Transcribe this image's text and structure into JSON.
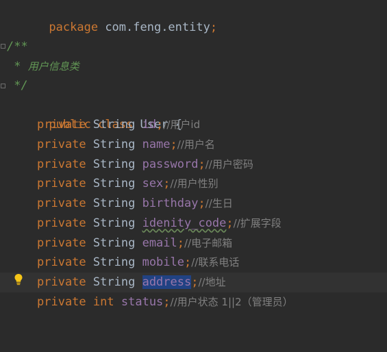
{
  "editor": {
    "lines": [
      {
        "id": "package",
        "parts": [
          "package",
          " com.feng.entity",
          ";"
        ]
      },
      {
        "id": "doc-open",
        "text": "/**"
      },
      {
        "id": "doc-body",
        "star": " * ",
        "text": "用户信息类"
      },
      {
        "id": "doc-close",
        "text": " */"
      },
      {
        "id": "class-decl",
        "kw1": "public",
        "kw2": "class",
        "name": "User",
        "brace": "{"
      }
    ],
    "fields": [
      {
        "mod": "private",
        "type": "String",
        "name": "id",
        "comment": "//用户id"
      },
      {
        "mod": "private",
        "type": "String",
        "name": "name",
        "comment": "//用户名"
      },
      {
        "mod": "private",
        "type": "String",
        "name": "password",
        "comment": "//用户密码"
      },
      {
        "mod": "private",
        "type": "String",
        "name": "sex",
        "comment": "//用户性别"
      },
      {
        "mod": "private",
        "type": "String",
        "name": "birthday",
        "comment": "//生日"
      },
      {
        "mod": "private",
        "type": "String",
        "name": "idenity_code",
        "comment": "//扩展字段"
      },
      {
        "mod": "private",
        "type": "String",
        "name": "email",
        "comment": "//电子邮箱"
      },
      {
        "mod": "private",
        "type": "String",
        "name": "mobile",
        "comment": "//联系电话"
      },
      {
        "mod": "private",
        "type": "String",
        "name": "address",
        "comment": "//地址"
      },
      {
        "mod": "private",
        "type": "int",
        "name": "status",
        "comment": "//用户状态 1||2（管理员）"
      }
    ],
    "colors": {
      "background": "#2b2b2b",
      "keyword": "#cc7832",
      "field": "#9876aa",
      "comment": "#808080",
      "doc": "#629755",
      "selection": "#214283",
      "bulb": "#f5c518"
    }
  }
}
